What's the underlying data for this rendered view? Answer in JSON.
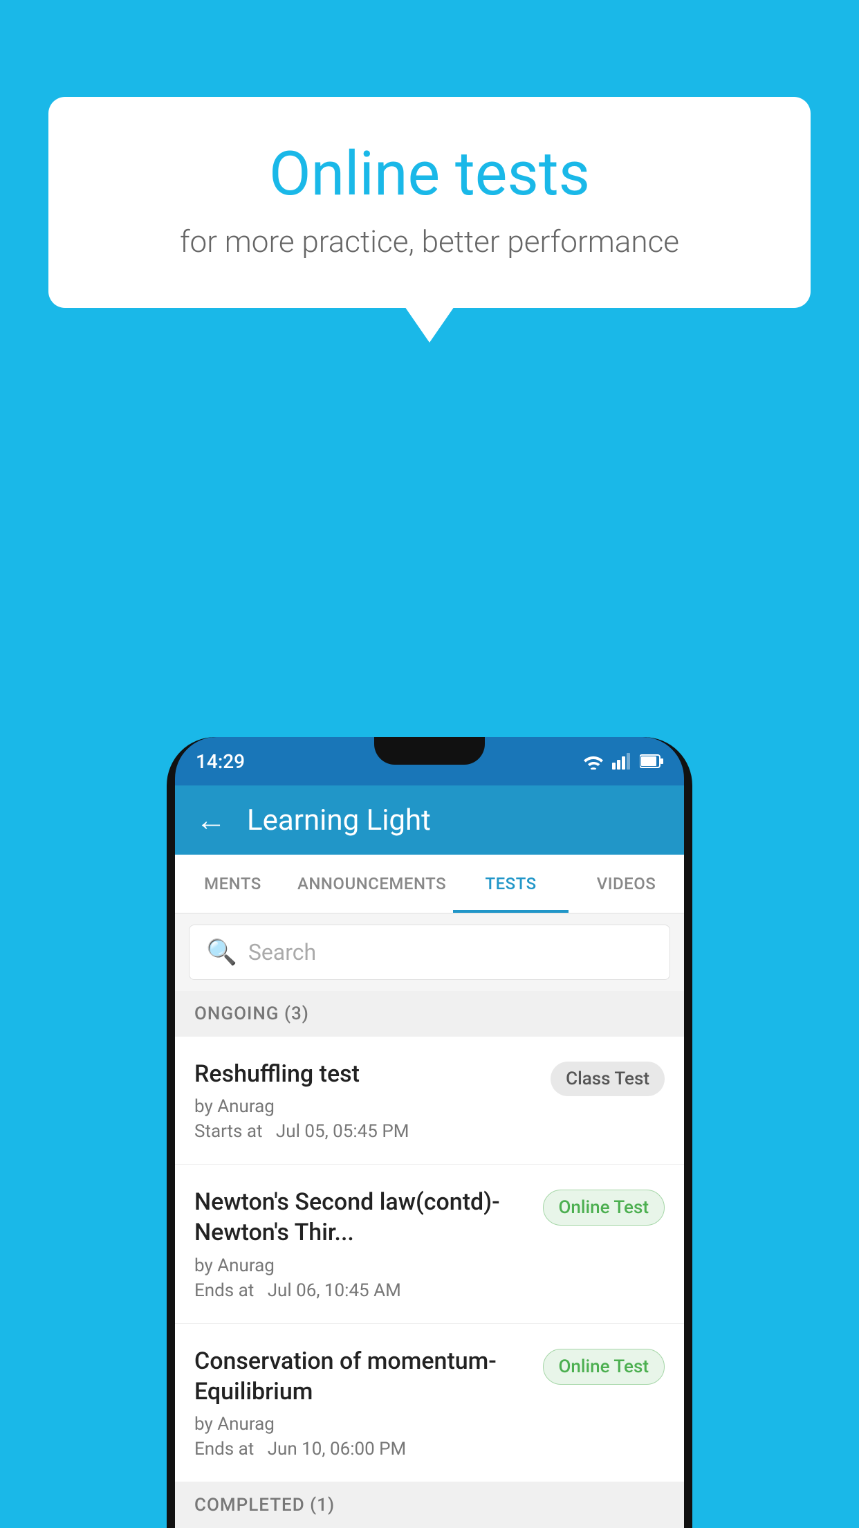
{
  "background": {
    "color": "#1ab8e8"
  },
  "speech_bubble": {
    "title": "Online tests",
    "subtitle": "for more practice, better performance"
  },
  "status_bar": {
    "time": "14:29",
    "icons": [
      "wifi",
      "signal",
      "battery"
    ]
  },
  "app_header": {
    "title": "Learning Light",
    "back_label": "←"
  },
  "tabs": [
    {
      "label": "MENTS",
      "active": false
    },
    {
      "label": "ANNOUNCEMENTS",
      "active": false
    },
    {
      "label": "TESTS",
      "active": true
    },
    {
      "label": "VIDEOS",
      "active": false
    }
  ],
  "search": {
    "placeholder": "Search"
  },
  "ongoing_section": {
    "label": "ONGOING (3)"
  },
  "tests": [
    {
      "title": "Reshuffling test",
      "author": "by Anurag",
      "time_label": "Starts at",
      "time_value": "Jul 05, 05:45 PM",
      "badge": "Class Test",
      "badge_type": "class"
    },
    {
      "title": "Newton's Second law(contd)-Newton's Thir...",
      "author": "by Anurag",
      "time_label": "Ends at",
      "time_value": "Jul 06, 10:45 AM",
      "badge": "Online Test",
      "badge_type": "online"
    },
    {
      "title": "Conservation of momentum-Equilibrium",
      "author": "by Anurag",
      "time_label": "Ends at",
      "time_value": "Jun 10, 06:00 PM",
      "badge": "Online Test",
      "badge_type": "online"
    }
  ],
  "completed_section": {
    "label": "COMPLETED (1)"
  }
}
